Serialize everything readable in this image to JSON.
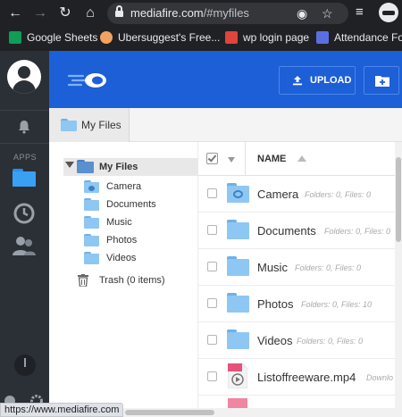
{
  "browser": {
    "url_host": "mediafire.com",
    "url_path": "/#myfiles",
    "bookmarks": [
      {
        "label": "Google Sheets",
        "color": "#0f9d58"
      },
      {
        "label": "Ubersuggest's Free...",
        "color": "#f4a261"
      },
      {
        "label": "wp login page",
        "color": "#e0443c"
      },
      {
        "label": "Attendance Form",
        "color": "#5b6ee1"
      }
    ],
    "status_url": "https://www.mediafire.com"
  },
  "sidebar": {
    "apps_label": "APPS"
  },
  "header": {
    "upload_label": "UPLOAD",
    "brand_color": "#1c5fd6"
  },
  "breadcrumb": {
    "label": "My Files"
  },
  "tree": {
    "root": "My Files",
    "children": [
      "Camera",
      "Documents",
      "Music",
      "Photos",
      "Videos"
    ],
    "trash": "Trash (0 items)"
  },
  "list": {
    "column_name": "NAME",
    "rows": [
      {
        "name": "Camera",
        "meta": "Folders: 0, Files: 0",
        "icon": "camera-folder-icon"
      },
      {
        "name": "Documents",
        "meta": "Folders: 0, Files: 0",
        "icon": "folder-icon"
      },
      {
        "name": "Music",
        "meta": "Folders: 0, Files: 0",
        "icon": "folder-icon"
      },
      {
        "name": "Photos",
        "meta": "Folders: 0, Files: 10",
        "icon": "folder-icon"
      },
      {
        "name": "Videos",
        "meta": "Folders: 0, Files: 0",
        "icon": "folder-icon"
      },
      {
        "name": "Listoffreeware.mp4",
        "meta": "Downlo",
        "icon": "video-file-icon"
      }
    ]
  }
}
